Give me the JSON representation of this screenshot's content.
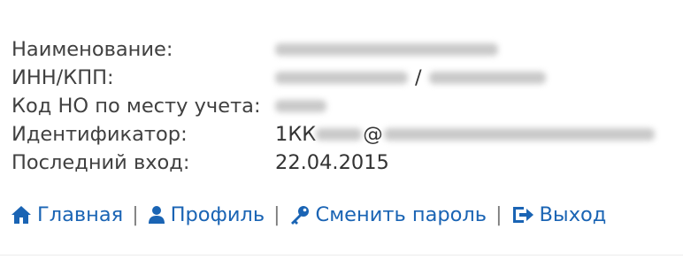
{
  "profile": {
    "name_label": "Наименование:",
    "inn_label": "ИНН/КПП:",
    "inn_separator": "/",
    "tax_office_label": "Код НО по месту учета:",
    "identifier_label": "Идентификатор:",
    "identifier_prefix": "1КК",
    "identifier_at": "@",
    "last_login_label": "Последний вход:",
    "last_login_value": "22.04.2015"
  },
  "nav": {
    "home": "Главная",
    "profile": "Профиль",
    "change_password": "Сменить пароль",
    "logout": "Выход",
    "separator": "|"
  },
  "colors": {
    "link": "#1a64b4",
    "label_text": "#404040",
    "redaction": "#c9c9c9"
  },
  "icons": {
    "home": "home-icon",
    "profile": "user-icon",
    "change_password": "key-icon",
    "logout": "logout-icon"
  }
}
